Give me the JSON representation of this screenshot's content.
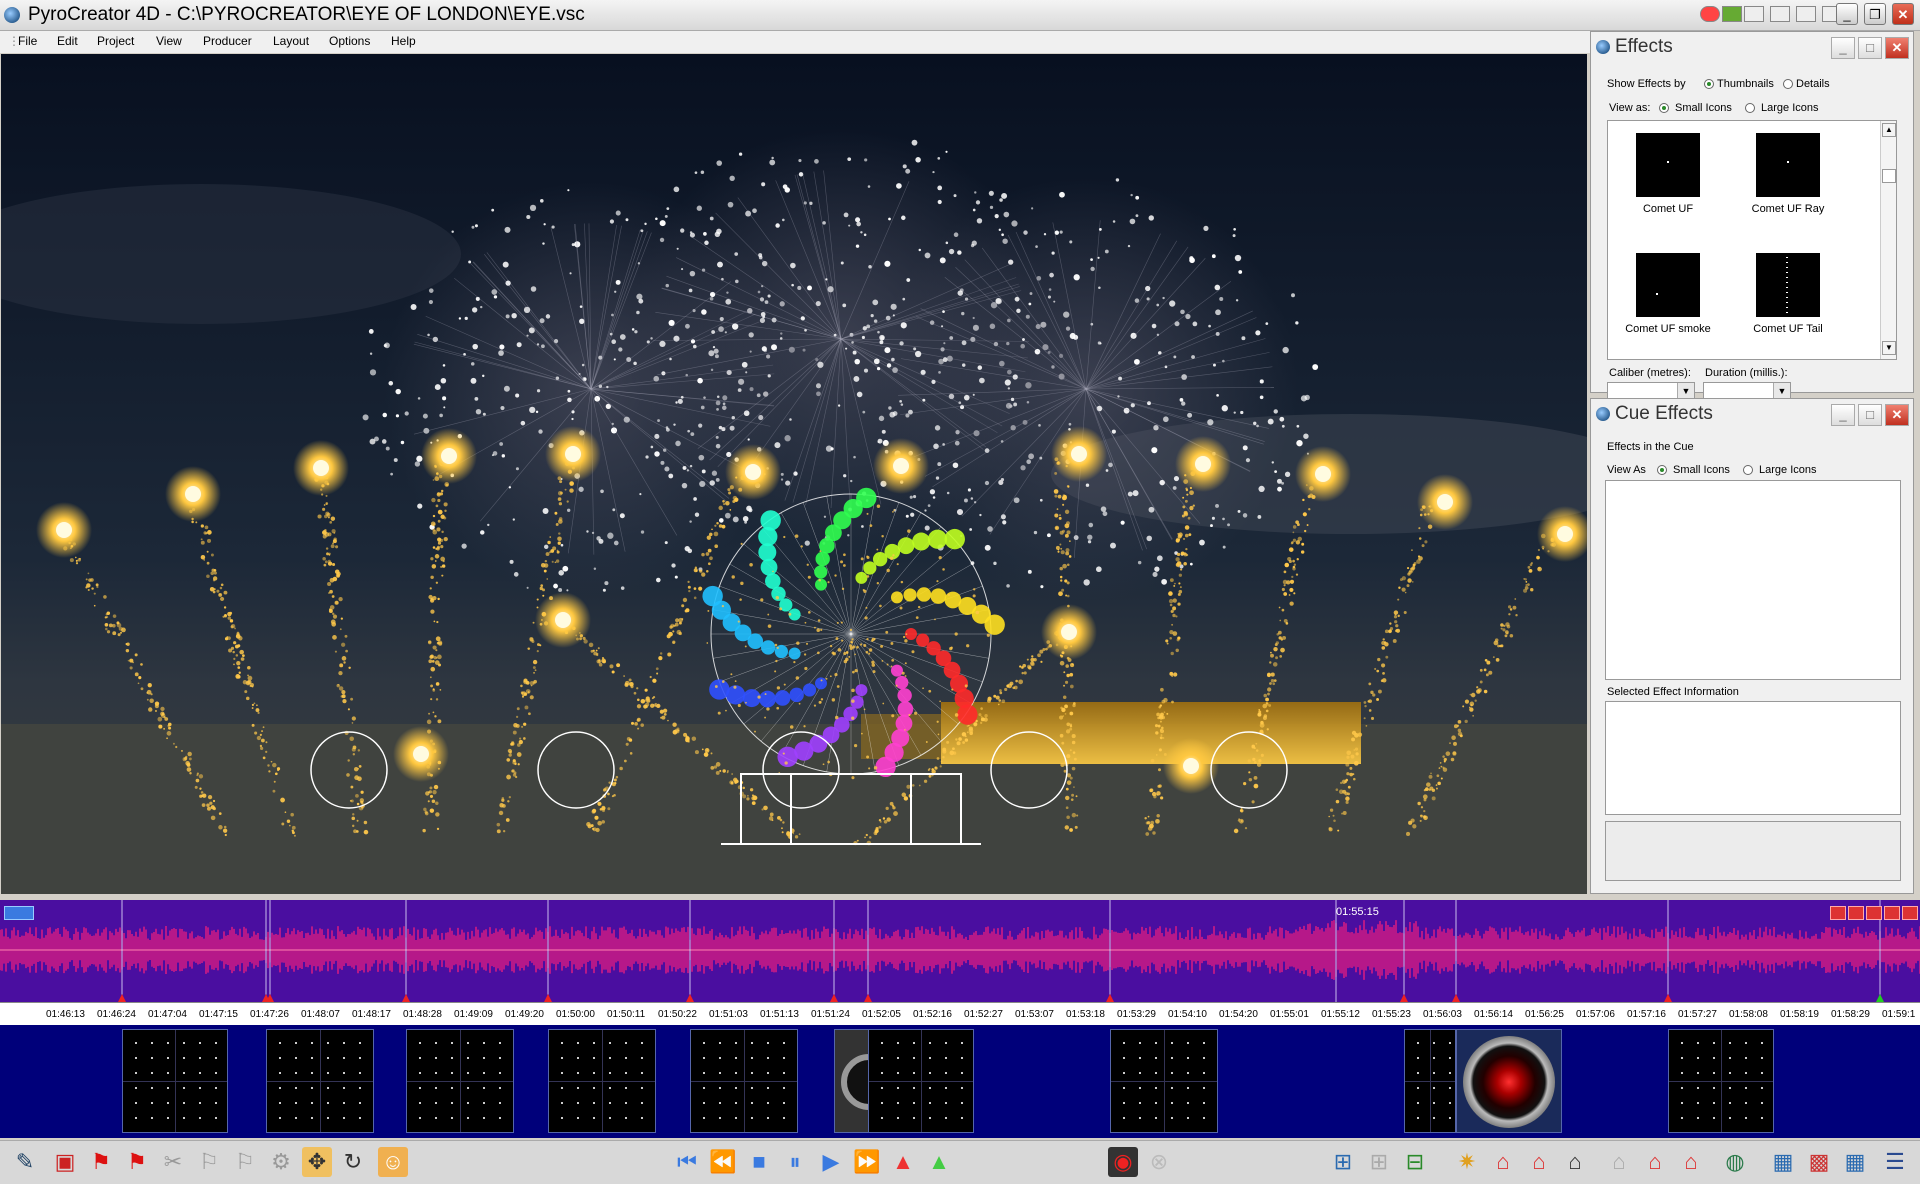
{
  "window": {
    "title": "PyroCreator 4D - C:\\PYROCREATOR\\EYE OF LONDON\\EYE.vsc",
    "minimize": "_",
    "restore": "❐",
    "close": "✕"
  },
  "menu": [
    "File",
    "Edit",
    "Project",
    "View",
    "Producer",
    "Layout",
    "Options",
    "Help"
  ],
  "effects_panel": {
    "title": "Effects",
    "show_by_label": "Show Effects by",
    "opt_thumbnails": "Thumbnails",
    "opt_details": "Details",
    "view_as_label": "View as:",
    "opt_small": "Small Icons",
    "opt_large": "Large Icons",
    "items": [
      {
        "label": "Comet UF"
      },
      {
        "label": "Comet UF Ray"
      },
      {
        "label": "Comet UF smoke"
      },
      {
        "label": "Comet UF Tail"
      }
    ],
    "caliber_label": "Caliber (metres):",
    "duration_label": "Duration (millis.):",
    "caliber_value": "",
    "duration_value": ""
  },
  "cue_panel": {
    "title": "Cue Effects",
    "effects_in_cue": "Effects in the Cue",
    "view_as_label": "View As",
    "opt_small": "Small Icons",
    "opt_large": "Large Icons",
    "selected_info": "Selected Effect Information"
  },
  "timeline": {
    "cursor_time": "01:55:15",
    "ticks": [
      "01:46:13",
      "01:46:24",
      "01:47:04",
      "01:47:15",
      "01:47:26",
      "01:48:07",
      "01:48:17",
      "01:48:28",
      "01:49:09",
      "01:49:20",
      "01:50:00",
      "01:50:11",
      "01:50:22",
      "01:51:03",
      "01:51:13",
      "01:51:24",
      "01:52:05",
      "01:52:16",
      "01:52:27",
      "01:53:07",
      "01:53:18",
      "01:53:29",
      "01:54:10",
      "01:54:20",
      "01:55:01",
      "01:55:12",
      "01:55:23",
      "01:56:03",
      "01:56:14",
      "01:56:25",
      "01:57:06",
      "01:57:16",
      "01:57:27",
      "01:58:08",
      "01:58:19",
      "01:58:29",
      "01:59:1"
    ]
  },
  "colors": {
    "waveform_bg": "#4a0ea0",
    "waveform": "#ff1f7a",
    "cue_track": "#00007a",
    "firework_gold": "#ffc84a"
  }
}
